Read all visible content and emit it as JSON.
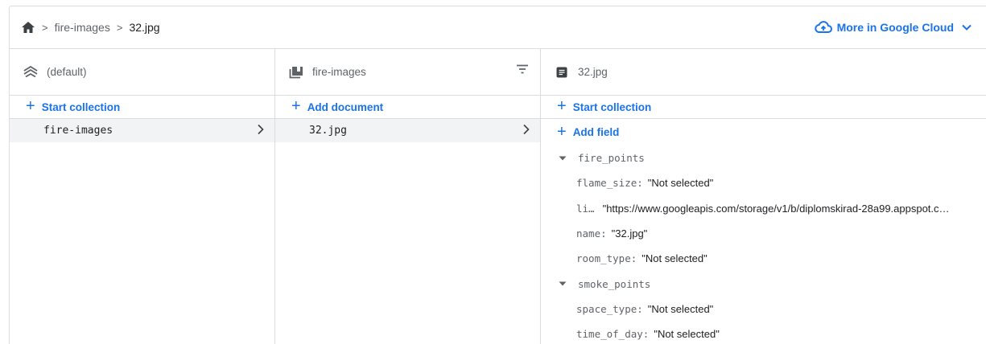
{
  "breadcrumb": {
    "items": [
      "fire-images",
      "32.jpg"
    ],
    "separator": ">"
  },
  "header": {
    "cloud_link": "More in Google Cloud"
  },
  "columns": {
    "root": {
      "title": "(default)",
      "action": "Start collection",
      "items": [
        {
          "label": "fire-images"
        }
      ]
    },
    "collection": {
      "title": "fire-images",
      "action": "Add document",
      "items": [
        {
          "label": "32.jpg"
        }
      ]
    },
    "document": {
      "title": "32.jpg",
      "action": "Start collection",
      "add_field": "Add field",
      "fields": [
        {
          "key": "fire_points"
        },
        {
          "key": "flame_size",
          "value": "\"Not selected\""
        },
        {
          "key": "li…",
          "value": "\"https://www.googleapis.com/storage/v1/b/diplomskirad-28a99.appspot.c…"
        },
        {
          "key": "name",
          "value": "\"32.jpg\""
        },
        {
          "key": "room_type",
          "value": "\"Not selected\""
        },
        {
          "key": "smoke_points"
        },
        {
          "key": "space_type",
          "value": "\"Not selected\""
        },
        {
          "key": "time_of_day",
          "value": "\"Not selected\""
        }
      ]
    }
  },
  "colors": {
    "accent": "#1a73e8",
    "border": "#dadce0",
    "selected_bg": "#f1f3f4"
  },
  "icons": [
    "home-icon",
    "cloud-icon",
    "chevron-down-icon",
    "database-icon",
    "collection-icon",
    "filter-icon",
    "document-icon",
    "plus-icon",
    "chevron-right-icon",
    "triangle-down-icon"
  ]
}
